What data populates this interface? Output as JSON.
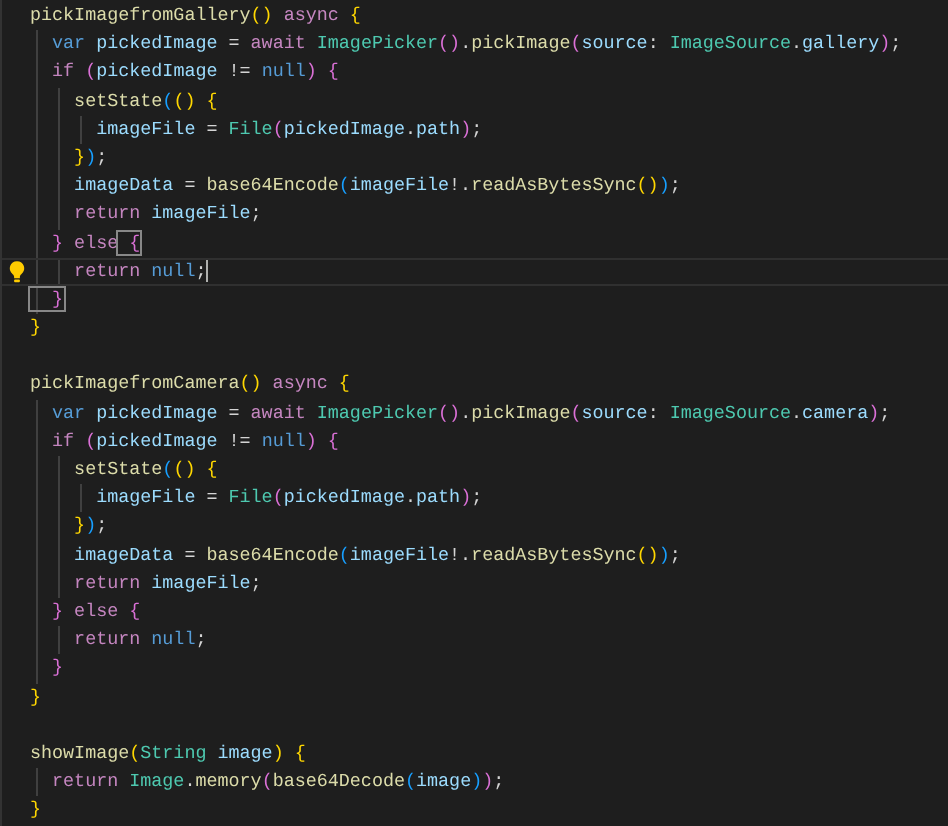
{
  "editor": {
    "lines": [
      {
        "current": false,
        "lightbulb": false,
        "cursor": false,
        "bracket_matched": false,
        "tokens": [
          {
            "text": "pickImagefromGallery",
            "kind": "function"
          },
          {
            "text": "()",
            "kind": "bracket1"
          },
          {
            "text": " async",
            "kind": "keyword"
          },
          {
            "text": " {",
            "kind": "bracket1"
          }
        ]
      },
      {
        "current": false,
        "lightbulb": false,
        "cursor": false,
        "bracket_matched": false,
        "tokens": [
          {
            "text": "  var",
            "kind": "storage"
          },
          {
            "text": " pickedImage",
            "kind": "variable"
          },
          {
            "text": " = ",
            "kind": "plain"
          },
          {
            "text": "await",
            "kind": "keyword"
          },
          {
            "text": " ImagePicker",
            "kind": "type"
          },
          {
            "text": "()",
            "kind": "bracket2"
          },
          {
            "text": ".",
            "kind": "plain"
          },
          {
            "text": "pickImage",
            "kind": "function"
          },
          {
            "text": "(",
            "kind": "bracket2"
          },
          {
            "text": "source",
            "kind": "variable"
          },
          {
            "text": ": ",
            "kind": "plain"
          },
          {
            "text": "ImageSource",
            "kind": "type"
          },
          {
            "text": ".",
            "kind": "plain"
          },
          {
            "text": "gallery",
            "kind": "variable"
          },
          {
            "text": ")",
            "kind": "bracket2"
          },
          {
            "text": ";",
            "kind": "plain"
          }
        ]
      },
      {
        "current": false,
        "lightbulb": false,
        "cursor": false,
        "bracket_matched": false,
        "tokens": [
          {
            "text": "  if",
            "kind": "keyword"
          },
          {
            "text": " (",
            "kind": "bracket2"
          },
          {
            "text": "pickedImage",
            "kind": "variable"
          },
          {
            "text": " != ",
            "kind": "plain"
          },
          {
            "text": "null",
            "kind": "storage"
          },
          {
            "text": ")",
            "kind": "bracket2"
          },
          {
            "text": " {",
            "kind": "bracket2"
          }
        ]
      },
      {
        "current": false,
        "lightbulb": false,
        "cursor": false,
        "bracket_matched": false,
        "tokens": [
          {
            "text": "    setState",
            "kind": "function"
          },
          {
            "text": "(",
            "kind": "bracket3"
          },
          {
            "text": "()",
            "kind": "bracket1"
          },
          {
            "text": " {",
            "kind": "bracket1"
          }
        ]
      },
      {
        "current": false,
        "lightbulb": false,
        "cursor": false,
        "bracket_matched": false,
        "tokens": [
          {
            "text": "      imageFile",
            "kind": "variable"
          },
          {
            "text": " = ",
            "kind": "plain"
          },
          {
            "text": "File",
            "kind": "type"
          },
          {
            "text": "(",
            "kind": "bracket2"
          },
          {
            "text": "pickedImage",
            "kind": "variable"
          },
          {
            "text": ".",
            "kind": "plain"
          },
          {
            "text": "path",
            "kind": "variable"
          },
          {
            "text": ")",
            "kind": "bracket2"
          },
          {
            "text": ";",
            "kind": "plain"
          }
        ]
      },
      {
        "current": false,
        "lightbulb": false,
        "cursor": false,
        "bracket_matched": false,
        "tokens": [
          {
            "text": "    }",
            "kind": "bracket1"
          },
          {
            "text": ")",
            "kind": "bracket3"
          },
          {
            "text": ";",
            "kind": "plain"
          }
        ]
      },
      {
        "current": false,
        "lightbulb": false,
        "cursor": false,
        "bracket_matched": false,
        "tokens": [
          {
            "text": "    imageData",
            "kind": "variable"
          },
          {
            "text": " = ",
            "kind": "plain"
          },
          {
            "text": "base64Encode",
            "kind": "function"
          },
          {
            "text": "(",
            "kind": "bracket3"
          },
          {
            "text": "imageFile",
            "kind": "variable"
          },
          {
            "text": "!.",
            "kind": "plain"
          },
          {
            "text": "readAsBytesSync",
            "kind": "function"
          },
          {
            "text": "()",
            "kind": "bracket1"
          },
          {
            "text": ")",
            "kind": "bracket3"
          },
          {
            "text": ";",
            "kind": "plain"
          }
        ]
      },
      {
        "current": false,
        "lightbulb": false,
        "cursor": false,
        "bracket_matched": false,
        "tokens": [
          {
            "text": "    return",
            "kind": "keyword"
          },
          {
            "text": " imageFile",
            "kind": "variable"
          },
          {
            "text": ";",
            "kind": "plain"
          }
        ]
      },
      {
        "current": false,
        "lightbulb": false,
        "cursor": false,
        "bracket_matched": true,
        "tokens": [
          {
            "text": "  }",
            "kind": "bracket2"
          },
          {
            "text": " else",
            "kind": "keyword"
          },
          {
            "text": " {",
            "kind": "bracket2"
          }
        ]
      },
      {
        "current": true,
        "lightbulb": true,
        "cursor": true,
        "bracket_matched": false,
        "tokens": [
          {
            "text": "    return",
            "kind": "keyword"
          },
          {
            "text": " null",
            "kind": "storage"
          },
          {
            "text": ";",
            "kind": "plain"
          }
        ]
      },
      {
        "current": false,
        "lightbulb": false,
        "cursor": false,
        "bracket_matched": true,
        "tokens": [
          {
            "text": "  }",
            "kind": "bracket2"
          }
        ]
      },
      {
        "current": false,
        "lightbulb": false,
        "cursor": false,
        "bracket_matched": false,
        "tokens": [
          {
            "text": "}",
            "kind": "bracket1"
          }
        ]
      },
      {
        "current": false,
        "lightbulb": false
      },
      {
        "current": false,
        "lightbulb": false,
        "cursor": false,
        "bracket_matched": false,
        "tokens": [
          {
            "text": "pickImagefromCamera",
            "kind": "function"
          },
          {
            "text": "()",
            "kind": "bracket1"
          },
          {
            "text": " async",
            "kind": "keyword"
          },
          {
            "text": " {",
            "kind": "bracket1"
          }
        ]
      },
      {
        "current": false,
        "lightbulb": false,
        "cursor": false,
        "bracket_matched": false,
        "tokens": [
          {
            "text": "  var",
            "kind": "storage"
          },
          {
            "text": " pickedImage",
            "kind": "variable"
          },
          {
            "text": " = ",
            "kind": "plain"
          },
          {
            "text": "await",
            "kind": "keyword"
          },
          {
            "text": " ImagePicker",
            "kind": "type"
          },
          {
            "text": "()",
            "kind": "bracket2"
          },
          {
            "text": ".",
            "kind": "plain"
          },
          {
            "text": "pickImage",
            "kind": "function"
          },
          {
            "text": "(",
            "kind": "bracket2"
          },
          {
            "text": "source",
            "kind": "variable"
          },
          {
            "text": ": ",
            "kind": "plain"
          },
          {
            "text": "ImageSource",
            "kind": "type"
          },
          {
            "text": ".",
            "kind": "plain"
          },
          {
            "text": "camera",
            "kind": "variable"
          },
          {
            "text": ")",
            "kind": "bracket2"
          },
          {
            "text": ";",
            "kind": "plain"
          }
        ]
      },
      {
        "current": false,
        "lightbulb": false,
        "cursor": false,
        "bracket_matched": false,
        "tokens": [
          {
            "text": "  if",
            "kind": "keyword"
          },
          {
            "text": " (",
            "kind": "bracket2"
          },
          {
            "text": "pickedImage",
            "kind": "variable"
          },
          {
            "text": " != ",
            "kind": "plain"
          },
          {
            "text": "null",
            "kind": "storage"
          },
          {
            "text": ")",
            "kind": "bracket2"
          },
          {
            "text": " {",
            "kind": "bracket2"
          }
        ]
      },
      {
        "current": false,
        "lightbulb": false,
        "cursor": false,
        "bracket_matched": false,
        "tokens": [
          {
            "text": "    setState",
            "kind": "function"
          },
          {
            "text": "(",
            "kind": "bracket3"
          },
          {
            "text": "()",
            "kind": "bracket1"
          },
          {
            "text": " {",
            "kind": "bracket1"
          }
        ]
      },
      {
        "current": false,
        "lightbulb": false,
        "cursor": false,
        "bracket_matched": false,
        "tokens": [
          {
            "text": "      imageFile",
            "kind": "variable"
          },
          {
            "text": " = ",
            "kind": "plain"
          },
          {
            "text": "File",
            "kind": "type"
          },
          {
            "text": "(",
            "kind": "bracket2"
          },
          {
            "text": "pickedImage",
            "kind": "variable"
          },
          {
            "text": ".",
            "kind": "plain"
          },
          {
            "text": "path",
            "kind": "variable"
          },
          {
            "text": ")",
            "kind": "bracket2"
          },
          {
            "text": ";",
            "kind": "plain"
          }
        ]
      },
      {
        "current": false,
        "lightbulb": false,
        "cursor": false,
        "bracket_matched": false,
        "tokens": [
          {
            "text": "    }",
            "kind": "bracket1"
          },
          {
            "text": ")",
            "kind": "bracket3"
          },
          {
            "text": ";",
            "kind": "plain"
          }
        ]
      },
      {
        "current": false,
        "lightbulb": false,
        "cursor": false,
        "bracket_matched": false,
        "tokens": [
          {
            "text": "    imageData",
            "kind": "variable"
          },
          {
            "text": " = ",
            "kind": "plain"
          },
          {
            "text": "base64Encode",
            "kind": "function"
          },
          {
            "text": "(",
            "kind": "bracket3"
          },
          {
            "text": "imageFile",
            "kind": "variable"
          },
          {
            "text": "!.",
            "kind": "plain"
          },
          {
            "text": "readAsBytesSync",
            "kind": "function"
          },
          {
            "text": "()",
            "kind": "bracket1"
          },
          {
            "text": ")",
            "kind": "bracket3"
          },
          {
            "text": ";",
            "kind": "plain"
          }
        ]
      },
      {
        "current": false,
        "lightbulb": false,
        "cursor": false,
        "bracket_matched": false,
        "tokens": [
          {
            "text": "    return",
            "kind": "keyword"
          },
          {
            "text": " imageFile",
            "kind": "variable"
          },
          {
            "text": ";",
            "kind": "plain"
          }
        ]
      },
      {
        "current": false,
        "lightbulb": false,
        "cursor": false,
        "bracket_matched": false,
        "tokens": [
          {
            "text": "  }",
            "kind": "bracket2"
          },
          {
            "text": " else",
            "kind": "keyword"
          },
          {
            "text": " {",
            "kind": "bracket2"
          }
        ]
      },
      {
        "current": false,
        "lightbulb": false,
        "cursor": false,
        "bracket_matched": false,
        "tokens": [
          {
            "text": "    return",
            "kind": "keyword"
          },
          {
            "text": " null",
            "kind": "storage"
          },
          {
            "text": ";",
            "kind": "plain"
          }
        ]
      },
      {
        "current": false,
        "lightbulb": false,
        "cursor": false,
        "bracket_matched": false,
        "tokens": [
          {
            "text": "  }",
            "kind": "bracket2"
          }
        ]
      },
      {
        "current": false,
        "lightbulb": false,
        "cursor": false,
        "bracket_matched": false,
        "tokens": [
          {
            "text": "}",
            "kind": "bracket1"
          }
        ]
      },
      {
        "current": false,
        "lightbulb": false
      },
      {
        "current": false,
        "lightbulb": false,
        "cursor": false,
        "bracket_matched": false,
        "tokens": [
          {
            "text": "showImage",
            "kind": "function"
          },
          {
            "text": "(",
            "kind": "bracket1"
          },
          {
            "text": "String",
            "kind": "type"
          },
          {
            "text": " image",
            "kind": "variable"
          },
          {
            "text": ")",
            "kind": "bracket1"
          },
          {
            "text": " {",
            "kind": "bracket1"
          }
        ]
      },
      {
        "current": false,
        "lightbulb": false,
        "cursor": false,
        "bracket_matched": false,
        "tokens": [
          {
            "text": "  return",
            "kind": "keyword"
          },
          {
            "text": " Image",
            "kind": "type"
          },
          {
            "text": ".",
            "kind": "plain"
          },
          {
            "text": "memory",
            "kind": "function"
          },
          {
            "text": "(",
            "kind": "bracket2"
          },
          {
            "text": "base64Decode",
            "kind": "function"
          },
          {
            "text": "(",
            "kind": "bracket3"
          },
          {
            "text": "image",
            "kind": "variable"
          },
          {
            "text": ")",
            "kind": "bracket3"
          },
          {
            "text": ")",
            "kind": "bracket2"
          },
          {
            "text": ";",
            "kind": "plain"
          }
        ]
      },
      {
        "current": false,
        "lightbulb": false,
        "cursor": false,
        "bracket_matched": false,
        "tokens": [
          {
            "text": "}",
            "kind": "bracket1"
          }
        ]
      }
    ]
  }
}
